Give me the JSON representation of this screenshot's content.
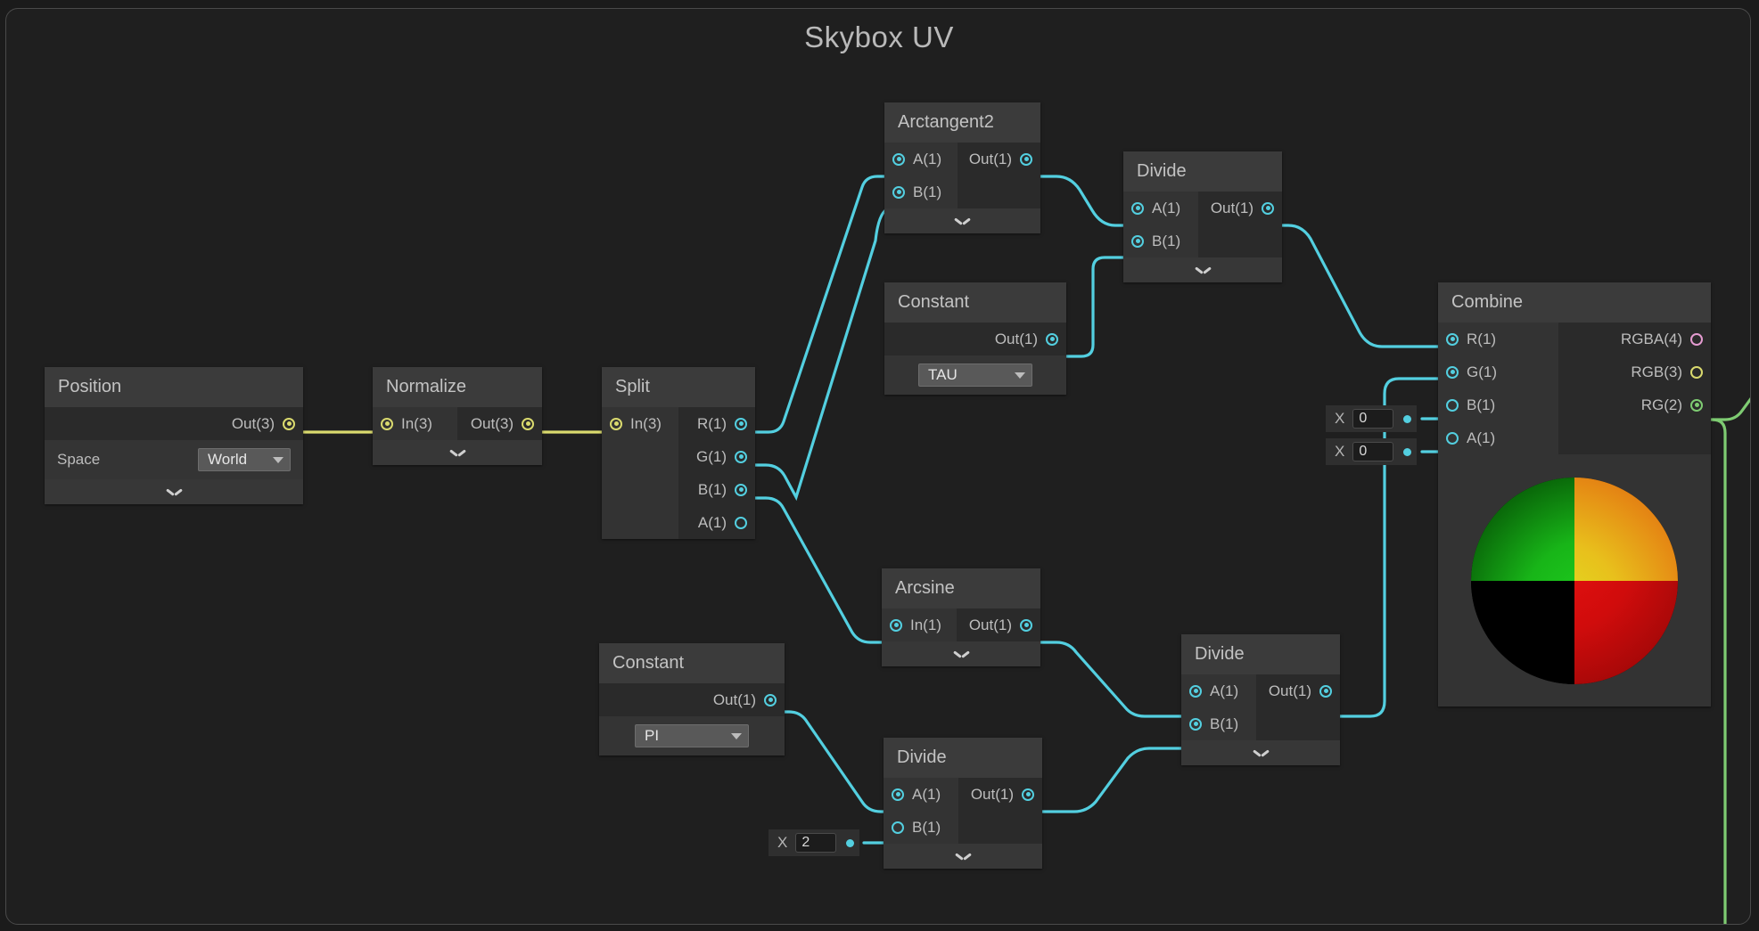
{
  "graph": {
    "title": "Skybox UV",
    "accent_wire_cyan": "#53cfe0",
    "accent_wire_yellow": "#dada6e",
    "accent_wire_green": "#7ecb72",
    "port_pink": "#e49bd0",
    "canvas_bg": "#1f1f1f",
    "node_bg": "#2d2d2d",
    "node_title_bg": "#3b3b3b"
  },
  "nodes": {
    "position": {
      "title": "Position",
      "outputs": [
        {
          "label": "Out(3)"
        }
      ],
      "property": {
        "label": "Space",
        "value": "World"
      }
    },
    "normalize": {
      "title": "Normalize",
      "inputs": [
        {
          "label": "In(3)"
        }
      ],
      "outputs": [
        {
          "label": "Out(3)"
        }
      ]
    },
    "split": {
      "title": "Split",
      "inputs": [
        {
          "label": "In(3)"
        }
      ],
      "outputs": [
        {
          "label": "R(1)"
        },
        {
          "label": "G(1)"
        },
        {
          "label": "B(1)"
        },
        {
          "label": "A(1)"
        }
      ]
    },
    "arctangent2": {
      "title": "Arctangent2",
      "inputs": [
        {
          "label": "A(1)"
        },
        {
          "label": "B(1)"
        }
      ],
      "outputs": [
        {
          "label": "Out(1)"
        }
      ]
    },
    "constant_tau": {
      "title": "Constant",
      "outputs": [
        {
          "label": "Out(1)"
        }
      ],
      "value": "TAU"
    },
    "divide_top": {
      "title": "Divide",
      "inputs": [
        {
          "label": "A(1)"
        },
        {
          "label": "B(1)"
        }
      ],
      "outputs": [
        {
          "label": "Out(1)"
        }
      ]
    },
    "arcsine": {
      "title": "Arcsine",
      "inputs": [
        {
          "label": "In(1)"
        }
      ],
      "outputs": [
        {
          "label": "Out(1)"
        }
      ]
    },
    "constant_pi": {
      "title": "Constant",
      "outputs": [
        {
          "label": "Out(1)"
        }
      ],
      "value": "PI"
    },
    "divide_bottom_left": {
      "title": "Divide",
      "inputs": [
        {
          "label": "A(1)"
        },
        {
          "label": "B(1)"
        }
      ],
      "outputs": [
        {
          "label": "Out(1)"
        }
      ]
    },
    "divide_bottom_right": {
      "title": "Divide",
      "inputs": [
        {
          "label": "A(1)"
        },
        {
          "label": "B(1)"
        }
      ],
      "outputs": [
        {
          "label": "Out(1)"
        }
      ]
    },
    "combine": {
      "title": "Combine",
      "inputs": [
        {
          "label": "R(1)"
        },
        {
          "label": "G(1)"
        },
        {
          "label": "B(1)"
        },
        {
          "label": "A(1)"
        }
      ],
      "outputs": [
        {
          "label": "RGBA(4)"
        },
        {
          "label": "RGB(3)"
        },
        {
          "label": "RG(2)"
        }
      ]
    }
  },
  "value_widgets": {
    "combine_b": {
      "axis": "X",
      "value": "0"
    },
    "combine_a": {
      "axis": "X",
      "value": "0"
    },
    "divide_b": {
      "axis": "X",
      "value": "2"
    }
  }
}
